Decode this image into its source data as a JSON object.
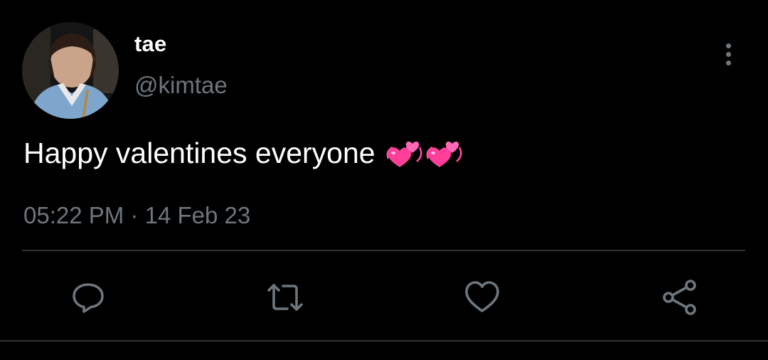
{
  "tweet": {
    "display_name": "tae",
    "handle": "@kimtae",
    "text": "Happy valentines everyone",
    "emoji": [
      "revolving-hearts",
      "revolving-hearts"
    ],
    "time": "05:22 PM",
    "separator": "·",
    "date": "14 Feb 23"
  },
  "actions": [
    {
      "name": "reply",
      "icon": "comment-icon"
    },
    {
      "name": "retweet",
      "icon": "retweet-icon"
    },
    {
      "name": "like",
      "icon": "heart-icon"
    },
    {
      "name": "share",
      "icon": "share-icon"
    }
  ],
  "colors": {
    "background": "#000000",
    "primary_text": "#ffffff",
    "secondary_text": "#6e767d",
    "divider": "#2f3336",
    "emoji_pink": "#ff4fa3"
  }
}
